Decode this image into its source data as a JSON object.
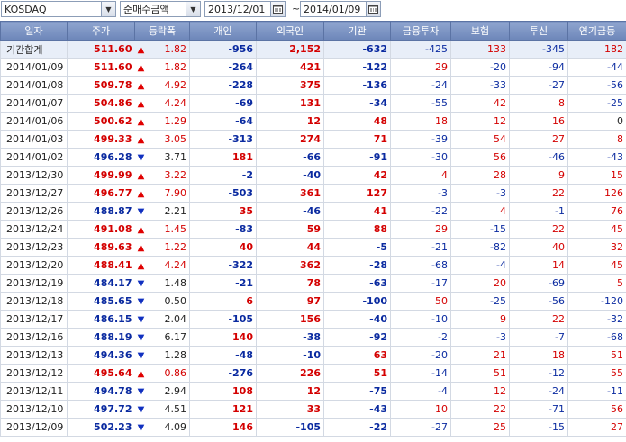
{
  "toolbar": {
    "market": "KOSDAQ",
    "type": "순매수금액",
    "start_date": "2013/12/01",
    "end_date": "2014/01/09",
    "range_sep": "~"
  },
  "headers": [
    "일자",
    "주가",
    "등락폭",
    "개인",
    "외국인",
    "기관",
    "금융투자",
    "보험",
    "투신",
    "연기금등"
  ],
  "rows": [
    {
      "date": "기간합계",
      "price": "511.60",
      "dir": "up",
      "chg": "1.82",
      "ind": "-956",
      "frn": "2,152",
      "inst": "-632",
      "fin": "-425",
      "ins": "133",
      "trust": "-345",
      "pen": "182"
    },
    {
      "date": "2014/01/09",
      "price": "511.60",
      "dir": "up",
      "chg": "1.82",
      "ind": "-264",
      "frn": "421",
      "inst": "-122",
      "fin": "29",
      "ins": "-20",
      "trust": "-94",
      "pen": "-44"
    },
    {
      "date": "2014/01/08",
      "price": "509.78",
      "dir": "up",
      "chg": "4.92",
      "ind": "-228",
      "frn": "375",
      "inst": "-136",
      "fin": "-24",
      "ins": "-33",
      "trust": "-27",
      "pen": "-56"
    },
    {
      "date": "2014/01/07",
      "price": "504.86",
      "dir": "up",
      "chg": "4.24",
      "ind": "-69",
      "frn": "131",
      "inst": "-34",
      "fin": "-55",
      "ins": "42",
      "trust": "8",
      "pen": "-25"
    },
    {
      "date": "2014/01/06",
      "price": "500.62",
      "dir": "up",
      "chg": "1.29",
      "ind": "-64",
      "frn": "12",
      "inst": "48",
      "fin": "18",
      "ins": "12",
      "trust": "16",
      "pen": "0"
    },
    {
      "date": "2014/01/03",
      "price": "499.33",
      "dir": "up",
      "chg": "3.05",
      "ind": "-313",
      "frn": "274",
      "inst": "71",
      "fin": "-39",
      "ins": "54",
      "trust": "27",
      "pen": "8"
    },
    {
      "date": "2014/01/02",
      "price": "496.28",
      "dir": "down",
      "chg": "3.71",
      "ind": "181",
      "frn": "-66",
      "inst": "-91",
      "fin": "-30",
      "ins": "56",
      "trust": "-46",
      "pen": "-43"
    },
    {
      "date": "2013/12/30",
      "price": "499.99",
      "dir": "up",
      "chg": "3.22",
      "ind": "-2",
      "frn": "-40",
      "inst": "42",
      "fin": "4",
      "ins": "28",
      "trust": "9",
      "pen": "15"
    },
    {
      "date": "2013/12/27",
      "price": "496.77",
      "dir": "up",
      "chg": "7.90",
      "ind": "-503",
      "frn": "361",
      "inst": "127",
      "fin": "-3",
      "ins": "-3",
      "trust": "22",
      "pen": "126"
    },
    {
      "date": "2013/12/26",
      "price": "488.87",
      "dir": "down",
      "chg": "2.21",
      "ind": "35",
      "frn": "-46",
      "inst": "41",
      "fin": "-22",
      "ins": "4",
      "trust": "-1",
      "pen": "76"
    },
    {
      "date": "2013/12/24",
      "price": "491.08",
      "dir": "up",
      "chg": "1.45",
      "ind": "-83",
      "frn": "59",
      "inst": "88",
      "fin": "29",
      "ins": "-15",
      "trust": "22",
      "pen": "45"
    },
    {
      "date": "2013/12/23",
      "price": "489.63",
      "dir": "up",
      "chg": "1.22",
      "ind": "40",
      "frn": "44",
      "inst": "-5",
      "fin": "-21",
      "ins": "-82",
      "trust": "40",
      "pen": "32"
    },
    {
      "date": "2013/12/20",
      "price": "488.41",
      "dir": "up",
      "chg": "4.24",
      "ind": "-322",
      "frn": "362",
      "inst": "-28",
      "fin": "-68",
      "ins": "-4",
      "trust": "14",
      "pen": "45"
    },
    {
      "date": "2013/12/19",
      "price": "484.17",
      "dir": "down",
      "chg": "1.48",
      "ind": "-21",
      "frn": "78",
      "inst": "-63",
      "fin": "-17",
      "ins": "20",
      "trust": "-69",
      "pen": "5"
    },
    {
      "date": "2013/12/18",
      "price": "485.65",
      "dir": "down",
      "chg": "0.50",
      "ind": "6",
      "frn": "97",
      "inst": "-100",
      "fin": "50",
      "ins": "-25",
      "trust": "-56",
      "pen": "-120"
    },
    {
      "date": "2013/12/17",
      "price": "486.15",
      "dir": "down",
      "chg": "2.04",
      "ind": "-105",
      "frn": "156",
      "inst": "-40",
      "fin": "-10",
      "ins": "9",
      "trust": "22",
      "pen": "-32"
    },
    {
      "date": "2013/12/16",
      "price": "488.19",
      "dir": "down",
      "chg": "6.17",
      "ind": "140",
      "frn": "-38",
      "inst": "-92",
      "fin": "-2",
      "ins": "-3",
      "trust": "-7",
      "pen": "-68"
    },
    {
      "date": "2013/12/13",
      "price": "494.36",
      "dir": "down",
      "chg": "1.28",
      "ind": "-48",
      "frn": "-10",
      "inst": "63",
      "fin": "-20",
      "ins": "21",
      "trust": "18",
      "pen": "51"
    },
    {
      "date": "2013/12/12",
      "price": "495.64",
      "dir": "up",
      "chg": "0.86",
      "ind": "-276",
      "frn": "226",
      "inst": "51",
      "fin": "-14",
      "ins": "51",
      "trust": "-12",
      "pen": "55"
    },
    {
      "date": "2013/12/11",
      "price": "494.78",
      "dir": "down",
      "chg": "2.94",
      "ind": "108",
      "frn": "12",
      "inst": "-75",
      "fin": "-4",
      "ins": "12",
      "trust": "-24",
      "pen": "-11"
    },
    {
      "date": "2013/12/10",
      "price": "497.72",
      "dir": "down",
      "chg": "4.51",
      "ind": "121",
      "frn": "33",
      "inst": "-43",
      "fin": "10",
      "ins": "22",
      "trust": "-71",
      "pen": "56"
    },
    {
      "date": "2013/12/09",
      "price": "502.23",
      "dir": "down",
      "chg": "4.09",
      "ind": "146",
      "frn": "-105",
      "inst": "-22",
      "fin": "-27",
      "ins": "25",
      "trust": "-15",
      "pen": "27"
    }
  ],
  "colors": {
    "up": "#d40000",
    "down": "#0a2aa0",
    "header_bg": "#7890c2",
    "summary_bg": "#e8eef8"
  },
  "icons": {
    "dropdown": "chevron-down-icon",
    "calendar": "calendar-icon",
    "up": "triangle-up-icon",
    "down": "triangle-down-icon"
  }
}
